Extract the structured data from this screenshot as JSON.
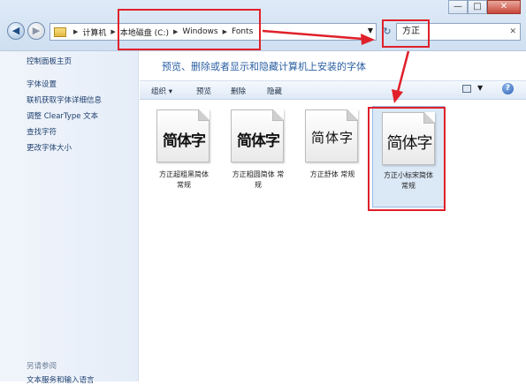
{
  "window": {
    "minimize": "—",
    "maximize": "□",
    "close": "✕"
  },
  "address": {
    "crumbs": [
      "计算机",
      "本地磁盘 (C:)",
      "Windows",
      "Fonts"
    ],
    "search_value": "方正"
  },
  "sidebar": {
    "items": [
      "控制面板主页",
      "字体设置",
      "联机获取字体详细信息",
      "调整 ClearType 文本",
      "查找字符",
      "更改字体大小"
    ],
    "see_also": "另请参阅",
    "bottom_item": "文本服务和输入语言"
  },
  "main": {
    "heading": "预览、删除或者显示和隐藏计算机上安装的字体",
    "commands": {
      "organize": "组织 ▾",
      "preview": "预览",
      "delete": "删除",
      "hide": "隐藏"
    },
    "fonts": [
      {
        "sample": "简体字",
        "name": "方正超粗黑简体",
        "style": "常规"
      },
      {
        "sample": "简体字",
        "name": "方正粗圆简体 常",
        "style": "规"
      },
      {
        "sample": "简体字",
        "name": "方正舒体 常规",
        "style": ""
      },
      {
        "sample": "简体字",
        "name": "方正小标宋简体",
        "style": "常规"
      }
    ]
  },
  "annotations": {
    "color": "#e0202a"
  }
}
